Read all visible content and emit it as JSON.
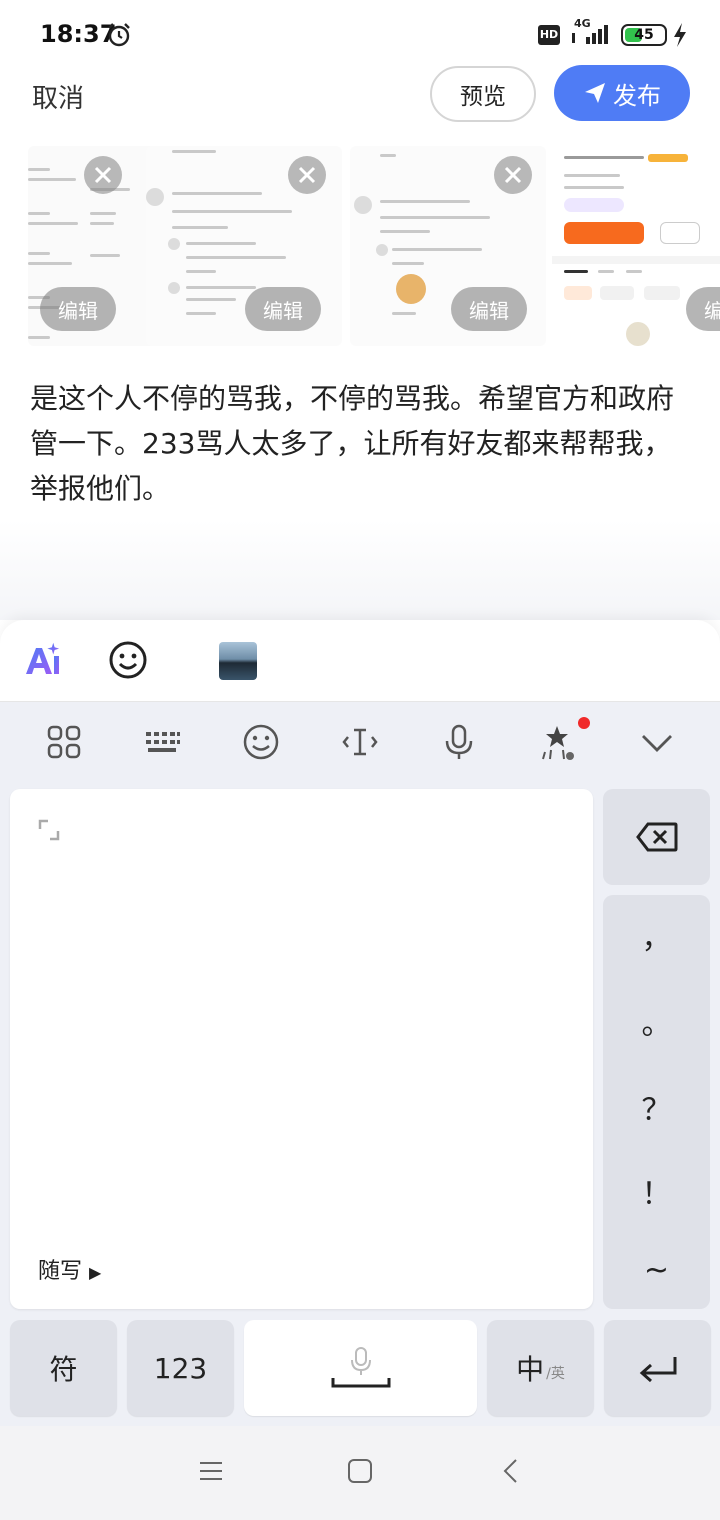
{
  "status": {
    "time": "18:37",
    "hd_badge": "HD",
    "network": "4G",
    "battery": "45",
    "battery_level": 0.45
  },
  "header": {
    "cancel_label": "取消",
    "preview_label": "预览",
    "publish_label": "发布"
  },
  "attachments": {
    "edit_label": "编辑",
    "items": [
      {
        "name": "screenshot-1"
      },
      {
        "name": "screenshot-2"
      },
      {
        "name": "screenshot-3"
      },
      {
        "name": "screenshot-4"
      }
    ]
  },
  "post": {
    "text": "是这个人不停的骂我，不停的骂我。希望官方和政府管一下。233骂人太多了，让所有好友都来帮帮我，举报他们。"
  },
  "toolbar": {
    "ai_label": "Ai",
    "icons": [
      "ai-icon",
      "emoji-icon",
      "image-icon"
    ]
  },
  "keyboard": {
    "toolbar_icons": [
      "grid-icon",
      "keyboard-icon",
      "emoji-icon",
      "cursor-icon",
      "mic-icon",
      "sparkle-icon",
      "collapse-icon"
    ],
    "handwriting_label": "随写",
    "punctuation": [
      "，",
      "。",
      "？",
      "！",
      "~"
    ],
    "keys": {
      "symbol": "符",
      "numbers": "123",
      "chinese": "中",
      "english_sub": "/英"
    }
  },
  "colors": {
    "accent": "#4f7cf5",
    "battery": "#32c24d",
    "notification_dot": "#f02a2a"
  }
}
